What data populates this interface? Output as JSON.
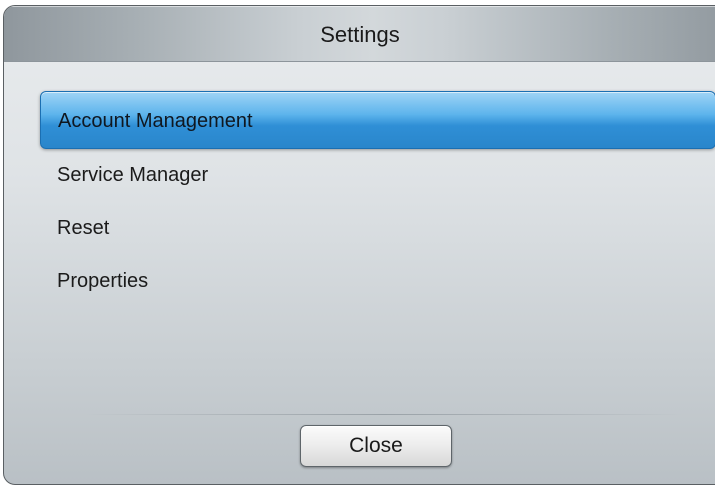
{
  "dialog": {
    "title": "Settings",
    "menu": {
      "items": [
        {
          "label": "Account Management",
          "selected": true
        },
        {
          "label": "Service Manager",
          "selected": false
        },
        {
          "label": "Reset",
          "selected": false
        },
        {
          "label": "Properties",
          "selected": false
        }
      ]
    },
    "close_label": "Close"
  },
  "colors": {
    "selection_highlight": "#2f8fd6",
    "background": "#dfe3e6",
    "title_bar": "#c9cfd3"
  }
}
